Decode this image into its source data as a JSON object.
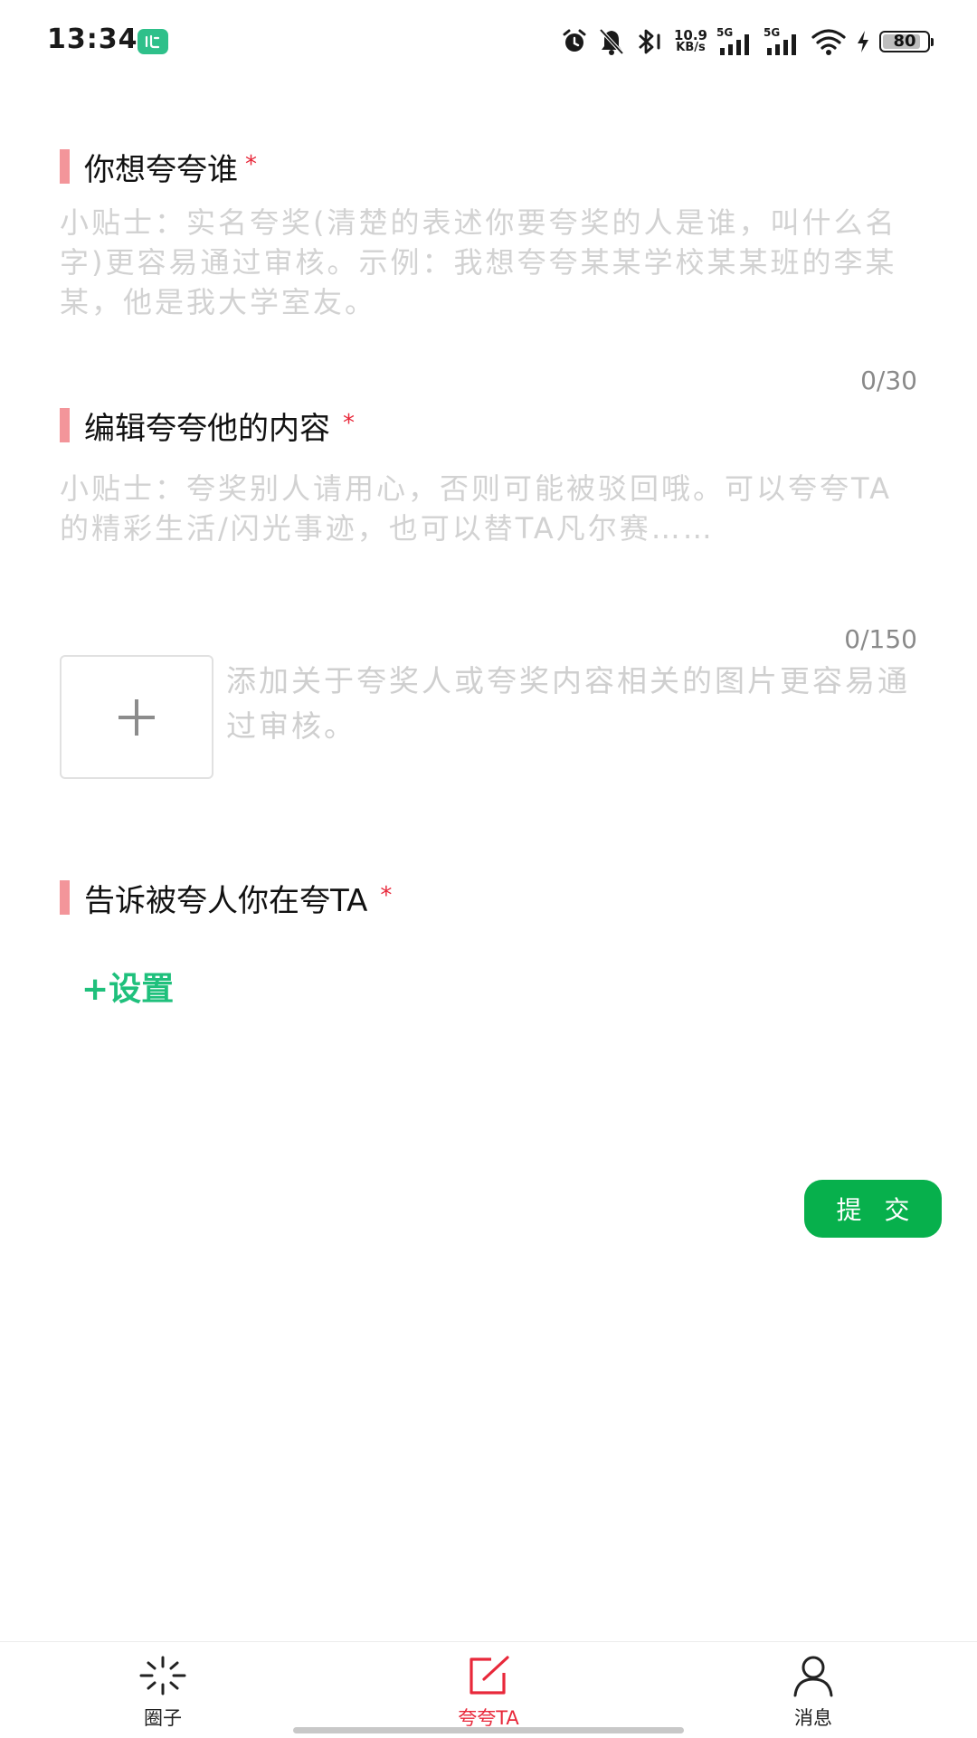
{
  "status_bar": {
    "time": "13:34",
    "net_speed_value": "10.9",
    "net_speed_unit": "KB/s",
    "signal_1_label": "5G",
    "signal_2_label": "5G",
    "battery_level": "80"
  },
  "form": {
    "who": {
      "title": "你想夸夸谁",
      "required_mark": "*",
      "placeholder": "小贴士：实名夸奖(清楚的表述你要夸奖的人是谁，叫什么名字)更容易通过审核。示例：我想夸夸某某学校某某班的李某某，他是我大学室友。",
      "char_count": "0/30"
    },
    "content": {
      "title": "编辑夸夸他的内容",
      "required_mark": "*",
      "placeholder": "小贴士：夸奖别人请用心，否则可能被驳回哦。可以夸夸TA的精彩生活/闪光事迹，也可以替TA凡尔赛……",
      "char_count": "0/150"
    },
    "image_upload": {
      "plus_label": "+",
      "hint": "添加关于夸奖人或夸奖内容相关的图片更容易通过审核。"
    },
    "notify": {
      "title": "告诉被夸人你在夸TA",
      "required_mark": "*",
      "set_link": "+设置"
    },
    "submit_label": "提 交"
  },
  "bottom_nav": {
    "items": [
      {
        "label": "圈子",
        "icon": "sparkle-icon"
      },
      {
        "label": "夸夸TA",
        "icon": "edit-square-icon",
        "active": true
      },
      {
        "label": "消息",
        "icon": "person-icon"
      }
    ],
    "colors": {
      "active": "#e8283a",
      "inactive": "#222222"
    }
  },
  "colors": {
    "accent_green": "#07b04c",
    "link_green": "#1fc07c",
    "title_bar_pink": "#f3959a",
    "required_red": "#e8283a"
  }
}
